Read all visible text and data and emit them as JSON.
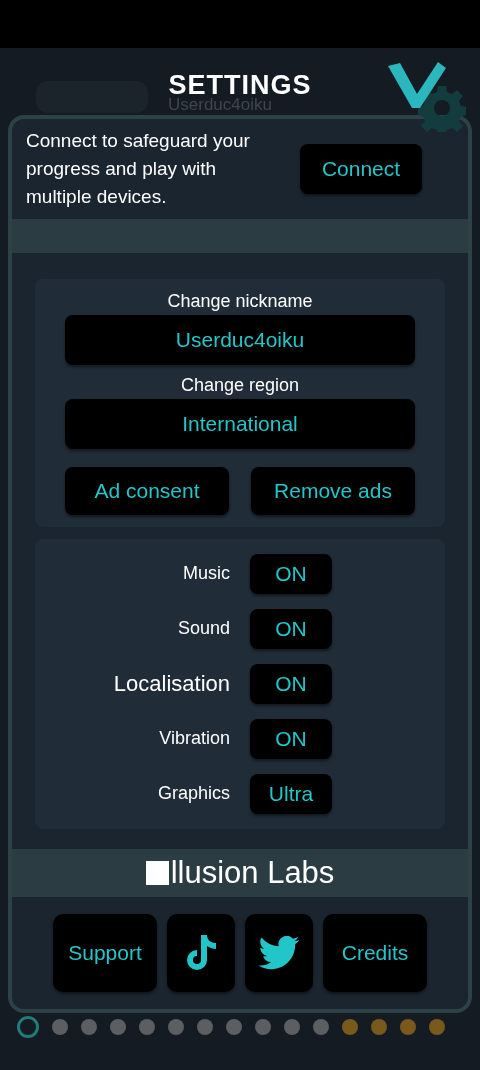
{
  "header": {
    "title": "SETTINGS",
    "background_username": "Userduc4oiku"
  },
  "connect": {
    "message": "Connect to safeguard your progress and play with multiple devices.",
    "button": "Connect"
  },
  "account": {
    "nickname_label": "Change nickname",
    "nickname": "Userduc4oiku",
    "region_label": "Change region",
    "region": "International",
    "buttons": [
      "Ad consent",
      "Remove ads"
    ]
  },
  "options": [
    {
      "label": "Music",
      "value": "ON",
      "kind": "normal"
    },
    {
      "label": "Sound",
      "value": "ON",
      "kind": "normal"
    },
    {
      "label": "Localisation",
      "value": "ON",
      "kind": "large"
    },
    {
      "label": "Vibration",
      "value": "ON",
      "kind": "normal"
    },
    {
      "label": "Graphics",
      "value": "Ultra",
      "kind": "normal"
    }
  ],
  "brand": {
    "name": "llusion Labs"
  },
  "links": [
    {
      "kind": "text",
      "label": "Support"
    },
    {
      "kind": "note"
    },
    {
      "kind": "bird"
    },
    {
      "kind": "text",
      "label": "Credits"
    }
  ],
  "page_dots": [
    {
      "selected": true,
      "color": "#1f7c7a"
    },
    {
      "selected": false,
      "color": "#5c5f62"
    },
    {
      "selected": false,
      "color": "#5c5f62"
    },
    {
      "selected": false,
      "color": "#5c5f62"
    },
    {
      "selected": false,
      "color": "#5c5f62"
    },
    {
      "selected": false,
      "color": "#5c5f62"
    },
    {
      "selected": false,
      "color": "#5c5f62"
    },
    {
      "selected": false,
      "color": "#5c5f62"
    },
    {
      "selected": false,
      "color": "#5c5f62"
    },
    {
      "selected": false,
      "color": "#5c5f62"
    },
    {
      "selected": false,
      "color": "#5c5f62"
    },
    {
      "selected": false,
      "color": "#7a5a1c"
    },
    {
      "selected": false,
      "color": "#7a5a1c"
    },
    {
      "selected": false,
      "color": "#7a5a1c"
    },
    {
      "selected": false,
      "color": "#7a5a1c"
    }
  ]
}
